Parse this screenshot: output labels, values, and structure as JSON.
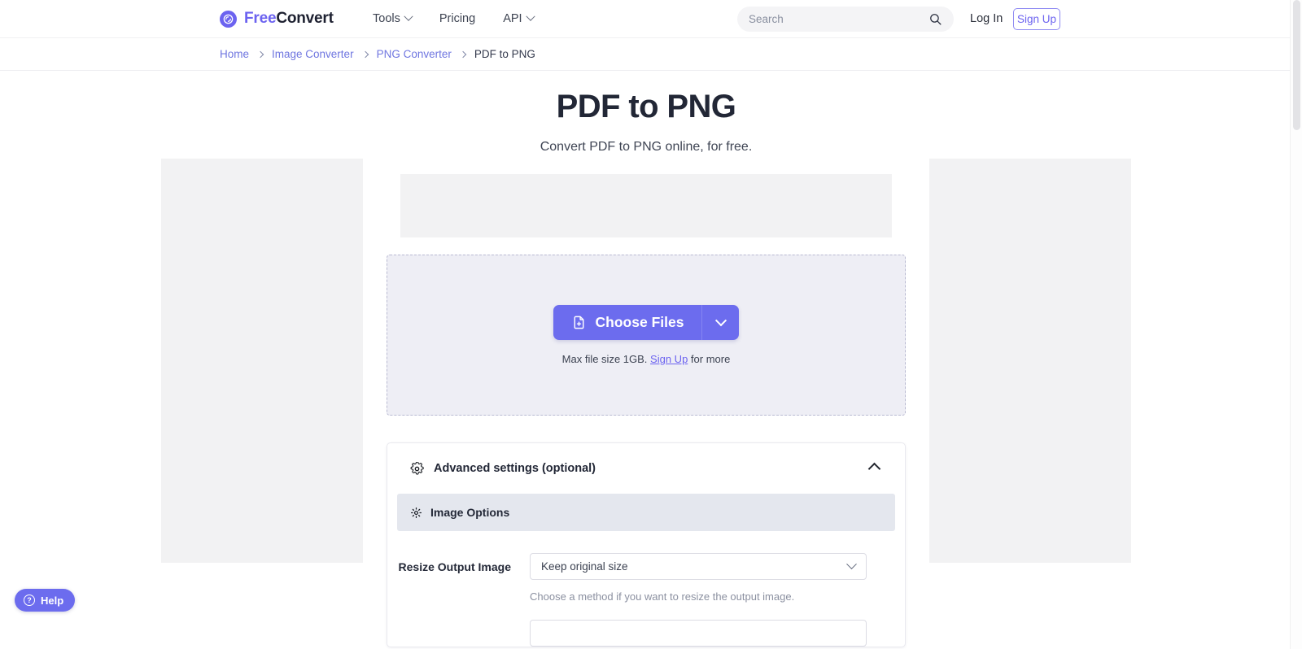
{
  "header": {
    "logo": {
      "icon": "refresh-circle-icon",
      "text_free": "Free",
      "text_convert": "Convert"
    },
    "nav": [
      {
        "label": "Tools",
        "has_caret": true
      },
      {
        "label": "Pricing",
        "has_caret": false
      },
      {
        "label": "API",
        "has_caret": true
      }
    ],
    "search": {
      "placeholder": "Search",
      "value": "",
      "icon": "search-icon"
    },
    "login_label": "Log In",
    "signup_label": "Sign Up"
  },
  "breadcrumb": [
    {
      "label": "Home",
      "current": false
    },
    {
      "label": "Image Converter",
      "current": false
    },
    {
      "label": "PNG Converter",
      "current": false
    },
    {
      "label": "PDF to PNG",
      "current": true
    }
  ],
  "main": {
    "title": "PDF to PNG",
    "subtitle": "Convert PDF to PNG online, for free.",
    "dropzone": {
      "choose_label": "Choose Files",
      "choose_icon": "file-plus-icon",
      "caret_icon": "chevron-down-icon",
      "maxsize_prefix": "Max file size 1GB.",
      "maxsize_link": "Sign Up",
      "maxsize_suffix": "for more"
    },
    "settings": {
      "header_label": "Advanced settings (optional)",
      "header_icon": "gear-icon",
      "toggle_icon": "chevron-up-icon",
      "section_label": "Image Options",
      "section_icon": "gear-icon",
      "fields": [
        {
          "label": "Resize Output Image",
          "value": "Keep original size",
          "help": "Choose a method if you want to resize the output image."
        }
      ]
    }
  },
  "help_widget": {
    "label": "Help",
    "icon": "question-circle-icon",
    "symbol": "?"
  },
  "colors": {
    "brand_purple": "#6c63f0",
    "button_purple": "#6c6cee",
    "dropzone_bg": "#eeeef5",
    "section_bg": "#e4e7ee",
    "ad_placeholder": "#f2f2f3"
  }
}
